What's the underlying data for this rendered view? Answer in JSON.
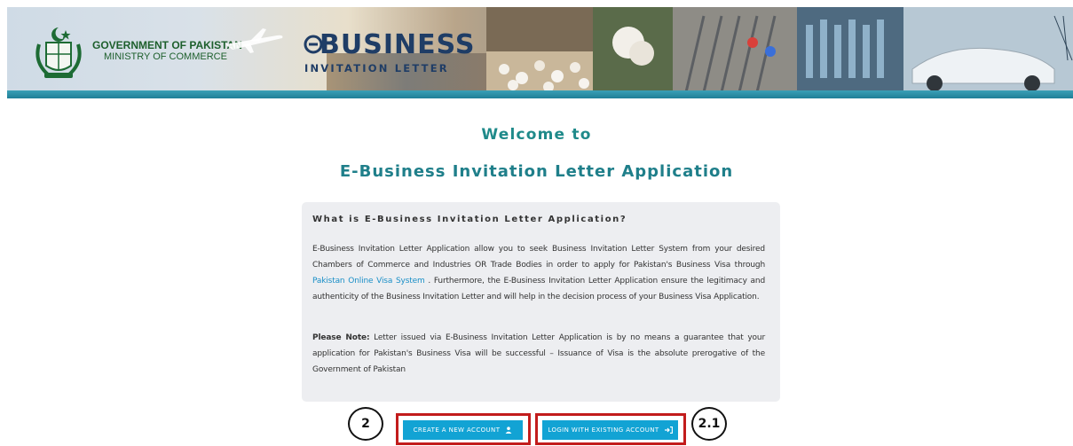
{
  "header": {
    "gov_title": "GOVERNMENT OF PAKISTAN",
    "gov_subtitle": "MINISTRY OF COMMERCE",
    "logo_title": "BUSINESS",
    "logo_subtitle": "INVITATION LETTER"
  },
  "main": {
    "welcome": "Welcome to",
    "app_title": "E-Business Invitation Letter Application"
  },
  "info": {
    "heading": "What is E-Business Invitation Letter Application?",
    "p1_before_link": "E-Business Invitation Letter Application allow you to seek Business Invitation Letter System from your desired Chambers of Commerce and Industries OR Trade Bodies in order to apply for Pakistan's Business Visa through ",
    "p1_link": "Pakistan Online Visa System",
    "p1_after_link": " . Furthermore, the E-Business Invitation Letter Application ensure the legitimacy and authenticity of the Business Invitation Letter and will help in the decision process of your Business Visa Application.",
    "note_label": "Please Note:",
    "note_text": " Letter issued via E-Business Invitation Letter Application is by no means a guarantee that your application for Pakistan's Business Visa will be successful – Issuance of Visa is the absolute prerogative of the Government of Pakistan"
  },
  "buttons": {
    "create_label": "CREATE A NEW ACCOUNT",
    "login_label": "LOGIN WITH EXISTING ACCOUNT"
  },
  "callouts": {
    "left": "2",
    "right": "2.1"
  },
  "icons": {
    "create": "user-icon",
    "login": "sign-in-icon"
  },
  "colors": {
    "accent": "#1f7f8a",
    "button": "#12a3d4",
    "highlight": "#c21c1c",
    "link": "#1a8fc7"
  }
}
